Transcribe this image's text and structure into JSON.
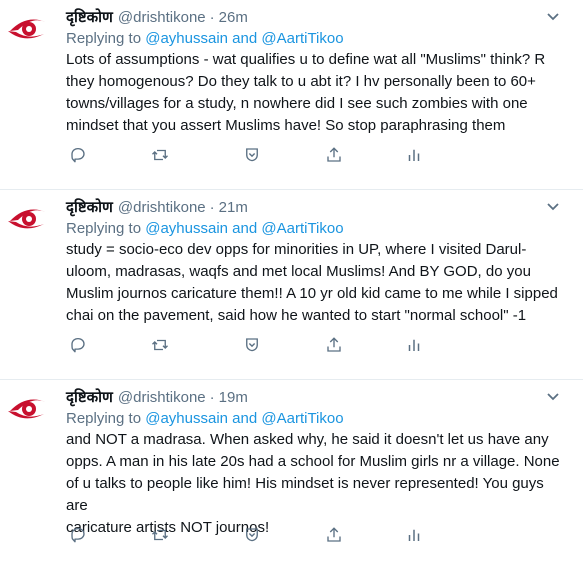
{
  "colors": {
    "accent": "#1b95e0",
    "muted": "#5b7083",
    "text": "#0f1419",
    "logo_red": "#c8102e"
  },
  "tweets": [
    {
      "name": "दृष्टिकोण",
      "handle": "@drishtikone",
      "dot": "·",
      "time": "26m",
      "reply_prefix": "Replying to",
      "mention1": "@ayhussain",
      "reply_and": "and",
      "mention2": "@AartiTikoo",
      "lines": [
        "Lots of assumptions - wat qualifies u to define wat all \"Muslims\" think? R",
        "they homogenous? Do they talk to u abt it? I hv personally been to 60+",
        "towns/villages for a study, n nowhere did I see such zombies with one",
        "mindset that you assert Muslims have! So stop paraphrasing them"
      ]
    },
    {
      "name": "दृष्टिकोण",
      "handle": "@drishtikone",
      "dot": "·",
      "time": "21m",
      "reply_prefix": "Replying to",
      "mention1": "@ayhussain",
      "reply_and": "and",
      "mention2": "@AartiTikoo",
      "lines": [
        "study = socio-eco dev opps for minorities in UP, where I visited Darul-",
        "uloom, madrasas, waqfs and met local Muslims!  And BY GOD, do you",
        "Muslim journos caricature them!! A 10 yr old kid came to me while I sipped",
        "chai on the pavement, said how he wanted to start \"normal school\" -1"
      ]
    },
    {
      "name": "दृष्टिकोण",
      "handle": "@drishtikone",
      "dot": "·",
      "time": "19m",
      "reply_prefix": "Replying to",
      "mention1": "@ayhussain",
      "reply_and": "and",
      "mention2": "@AartiTikoo",
      "lines": [
        "and NOT a madrasa. When asked why, he said it doesn't let us have any",
        "opps. A man in his late 20s had a school for Muslim girls nr a village. None",
        "of u talks to people like him! His mindset is never represented! You guys are",
        "caricature artists NOT journos!"
      ]
    }
  ],
  "icons": {
    "caret": "chevron-down-icon",
    "reply": "reply-icon",
    "retweet": "retweet-icon",
    "like": "like-icon",
    "share": "share-icon",
    "analytics": "analytics-icon"
  }
}
